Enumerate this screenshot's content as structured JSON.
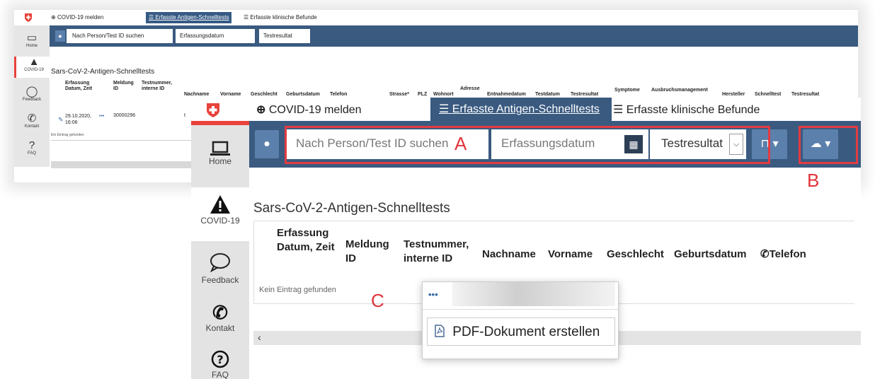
{
  "top_tabs": {
    "report": "COVID-19 melden",
    "antigen": "Erfasste Antigen-Schnelltests",
    "clinical": "Erfasste klinische Befunde"
  },
  "toolbar": {
    "search_placeholder": "Nach Person/Test ID suchen",
    "date_placeholder": "Erfassungsdatum",
    "result_select": "Testresultat"
  },
  "sidebar": {
    "home": "Home",
    "covid": "COVID-19",
    "feedback": "Feedback",
    "contact": "Kontakt",
    "faq": "FAQ"
  },
  "page_title": "Sars-CoV-2-Antigen-Schnelltests",
  "table_small": {
    "headers": [
      "Erfassung Datum, Zeit",
      "Meldung ID",
      "Testnummer, interne ID",
      "Nachname",
      "Vorname",
      "Geschlecht",
      "Geburtsdatum",
      "Telefon",
      "Strasse*",
      "PLZ",
      "Wohnort",
      "Adresse",
      "Entnahmedatum",
      "Testdatum",
      "Testresultat",
      "Symptome",
      "Ausbruchsmanagement",
      "Hersteller",
      "Schnelltest",
      "Testresultat"
    ],
    "row": {
      "date": "29.10.2020, 16:06",
      "dots": "•••",
      "id": "30000296",
      "trunc": "t"
    },
    "empty_note": "Ein Eintrag gefunden"
  },
  "table_zoom": {
    "headers": [
      "Erfassung Datum, Zeit",
      "Meldung ID",
      "Testnummer, interne ID",
      "Nachname",
      "Vorname",
      "Geschlecht",
      "Geburtsdatum",
      "Telefon"
    ],
    "empty_note": "Kein Eintrag gefunden"
  },
  "popup": {
    "dots": "•••",
    "pdf_label": "PDF-Dokument erstellen"
  },
  "callouts": {
    "a": "A",
    "b": "B",
    "c": "C"
  },
  "colors": {
    "toolbar": "#3a5a80",
    "accent_red": "#e33b41",
    "swiss_red": "#e8423b"
  }
}
